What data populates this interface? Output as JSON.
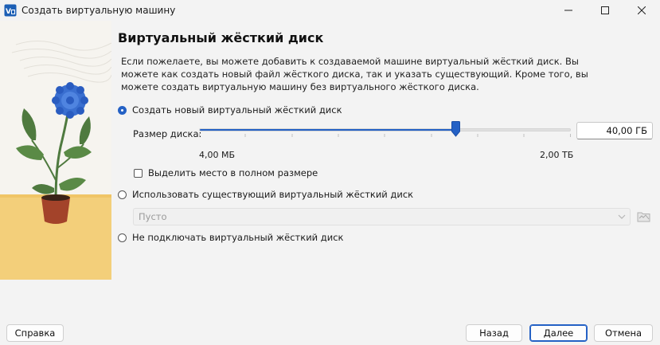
{
  "window": {
    "title": "Создать виртуальную машину"
  },
  "page": {
    "heading": "Виртуальный жёсткий диск",
    "description": "Если пожелаете, вы можете добавить к создаваемой машине виртуальный жёсткий диск. Вы можете как создать новый файл жёсткого диска, так и указать существующий. Кроме того, вы можете создать виртуальную машину без виртуального жёсткого диска."
  },
  "options": {
    "create_new": {
      "label": "Создать новый виртуальный жёсткий диск",
      "checked": true
    },
    "use_existing": {
      "label": "Использовать существующий виртуальный жёсткий диск",
      "checked": false
    },
    "no_disk": {
      "label": "Не подключать виртуальный жёсткий диск",
      "checked": false
    }
  },
  "disk_size": {
    "label": "Размер диска:",
    "value": "40,00 ГБ",
    "min_label": "4,00 МБ",
    "max_label": "2,00 ТБ",
    "slider_fraction": 0.69
  },
  "preallocate": {
    "label": "Выделить место в полном размере",
    "checked": false
  },
  "existing_disk": {
    "selected": "Пусто"
  },
  "buttons": {
    "help": "Справка",
    "back": "Назад",
    "next": "Далее",
    "cancel": "Отмена"
  },
  "colors": {
    "accent": "#2461c5",
    "flower": "#3a6fd0",
    "pot": "#a3432a",
    "ground": "#f3cf7a",
    "leaves": "#4f7a3f"
  }
}
